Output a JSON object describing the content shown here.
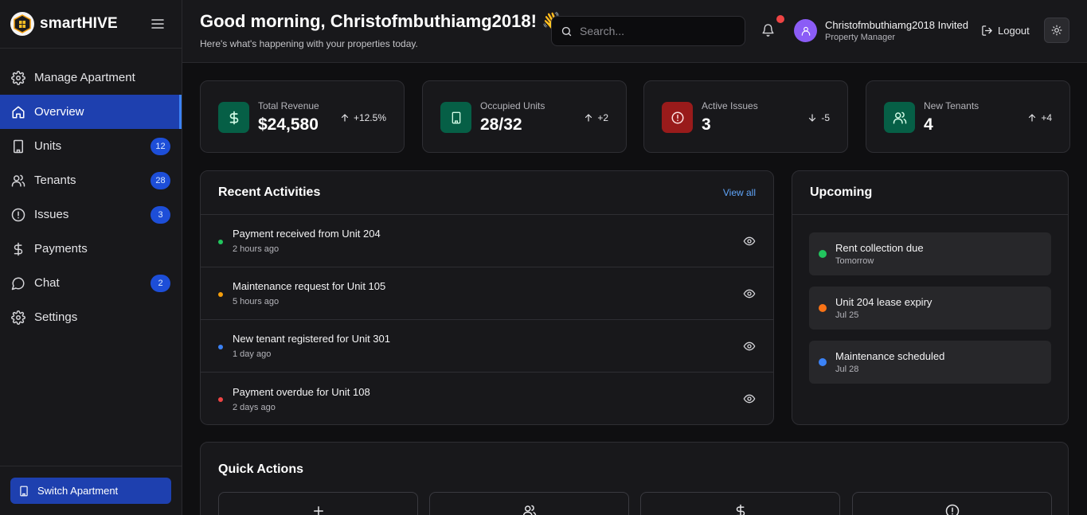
{
  "brand": {
    "name": "smartHIVE",
    "logo_icon": "hive-logo-icon"
  },
  "sidebar": {
    "items": [
      {
        "label": "Manage Apartment",
        "icon": "gear-icon",
        "badge": null,
        "active": false
      },
      {
        "label": "Overview",
        "icon": "home-icon",
        "badge": null,
        "active": true
      },
      {
        "label": "Units",
        "icon": "building-icon",
        "badge": "12",
        "active": false
      },
      {
        "label": "Tenants",
        "icon": "users-icon",
        "badge": "28",
        "active": false
      },
      {
        "label": "Issues",
        "icon": "alert-circle-icon",
        "badge": "3",
        "active": false
      },
      {
        "label": "Payments",
        "icon": "dollar-icon",
        "badge": null,
        "active": false
      },
      {
        "label": "Chat",
        "icon": "chat-bubble-icon",
        "badge": "2",
        "active": false
      },
      {
        "label": "Settings",
        "icon": "gear-icon",
        "badge": null,
        "active": false
      }
    ],
    "switch_label": "Switch Apartment"
  },
  "header": {
    "greeting": "Good morning, Christofmbuthiamg2018! 👋",
    "subtitle": "Here's what's happening with your properties today.",
    "search_placeholder": "Search...",
    "user_name": "Christofmbuthiamg2018 Invited",
    "user_role": "Property Manager",
    "logout_label": "Logout"
  },
  "stats": [
    {
      "label": "Total Revenue",
      "value": "$24,580",
      "change": "+12.5%",
      "direction": "up",
      "icon": "dollar-icon",
      "color": "#065f46"
    },
    {
      "label": "Occupied Units",
      "value": "28/32",
      "change": "+2",
      "direction": "up",
      "icon": "building-icon",
      "color": "#065f46"
    },
    {
      "label": "Active Issues",
      "value": "3",
      "change": "-5",
      "direction": "down",
      "icon": "alert-circle-icon",
      "color": "#991b1b"
    },
    {
      "label": "New Tenants",
      "value": "4",
      "change": "+4",
      "direction": "up",
      "icon": "users-icon",
      "color": "#065f46"
    }
  ],
  "activities": {
    "title": "Recent Activities",
    "view_all": "View all",
    "items": [
      {
        "text": "Payment received from Unit 204",
        "time": "2 hours ago",
        "color": "#22c55e"
      },
      {
        "text": "Maintenance request for Unit 105",
        "time": "5 hours ago",
        "color": "#f59e0b"
      },
      {
        "text": "New tenant registered for Unit 301",
        "time": "1 day ago",
        "color": "#3b82f6"
      },
      {
        "text": "Payment overdue for Unit 108",
        "time": "2 days ago",
        "color": "#ef4444"
      }
    ]
  },
  "upcoming": {
    "title": "Upcoming",
    "items": [
      {
        "title": "Rent collection due",
        "date": "Tomorrow",
        "color": "#22c55e"
      },
      {
        "title": "Unit 204 lease expiry",
        "date": "Jul 25",
        "color": "#f97316"
      },
      {
        "title": "Maintenance scheduled",
        "date": "Jul 28",
        "color": "#3b82f6"
      }
    ]
  },
  "quick_actions": {
    "title": "Quick Actions",
    "items": [
      {
        "icon": "plus-icon"
      },
      {
        "icon": "users-icon"
      },
      {
        "icon": "dollar-icon"
      },
      {
        "icon": "alert-circle-icon"
      }
    ]
  }
}
